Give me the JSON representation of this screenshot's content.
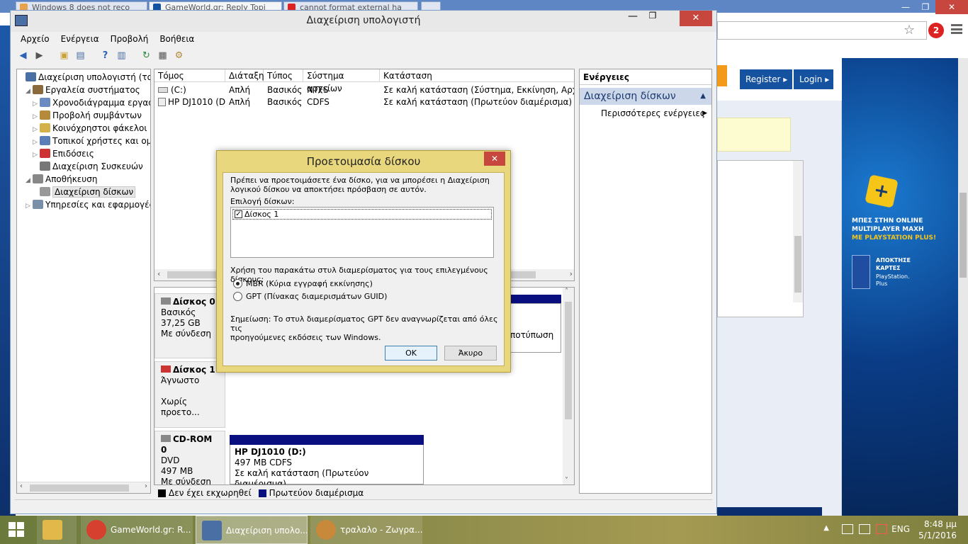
{
  "browser": {
    "tabs": [
      {
        "label": "Windows 8 does not reco",
        "color": "#e8a24a"
      },
      {
        "label": "GameWorld.gr: Reply Topi",
        "color": "#1553a0"
      },
      {
        "label": "cannot format external ha",
        "color": "#d22"
      }
    ],
    "ext_badge": "2",
    "site": {
      "register": "Register ▸",
      "login": "Login ▸",
      "ps_line1": "ΜΠΕΣ ΣΤΗΝ ONLINE",
      "ps_line2": "MULTIPLAYER ΜΑΧΗ",
      "ps_line3": "ΜΕ PLAYSTATION PLUS!",
      "ps_card1": "ΑΠΟΚΤΗΣΕ",
      "ps_card2": "ΚΑΡΤΕΣ",
      "ps_card3": "PlayStation.",
      "ps_card4": "Plus"
    }
  },
  "window": {
    "title": "Διαχείριση υπολογιστή",
    "close": "✕",
    "minimize": "—",
    "maximize": "❐"
  },
  "menubar": [
    "Αρχείο",
    "Ενέργεια",
    "Προβολή",
    "Βοήθεια"
  ],
  "tree": [
    {
      "label": "Διαχείριση υπολογιστή (τοπικού",
      "indent": 0,
      "icon": "computer-icon",
      "color": "#4a6fa5",
      "expander": ""
    },
    {
      "label": "Εργαλεία συστήματος",
      "indent": 1,
      "icon": "tools-icon",
      "color": "#8a6a3a",
      "expander": "◢"
    },
    {
      "label": "Χρονοδιάγραμμα εργασιώ",
      "indent": 2,
      "icon": "clock-icon",
      "color": "#6b8cc2",
      "expander": "▷"
    },
    {
      "label": "Προβολή συμβάντων",
      "indent": 2,
      "icon": "event-viewer-icon",
      "color": "#b58a3a",
      "expander": "▷"
    },
    {
      "label": "Κοινόχρηστοι φάκελοι",
      "indent": 2,
      "icon": "shared-folder-icon",
      "color": "#d4b24a",
      "expander": "▷"
    },
    {
      "label": "Τοπικοί χρήστες και ομάδ",
      "indent": 2,
      "icon": "users-icon",
      "color": "#5a7fb8",
      "expander": "▷"
    },
    {
      "label": "Επιδόσεις",
      "indent": 2,
      "icon": "performance-icon",
      "color": "#c33",
      "expander": "▷"
    },
    {
      "label": "Διαχείριση Συσκευών",
      "indent": 2,
      "icon": "device-manager-icon",
      "color": "#777",
      "expander": ""
    },
    {
      "label": "Αποθήκευση",
      "indent": 1,
      "icon": "storage-icon",
      "color": "#888",
      "expander": "◢"
    },
    {
      "label": "Διαχείριση δίσκων",
      "indent": 2,
      "icon": "disk-management-icon",
      "color": "#999",
      "expander": "",
      "selected": true
    },
    {
      "label": "Υπηρεσίες και εφαρμογές",
      "indent": 1,
      "icon": "services-icon",
      "color": "#7a8fa8",
      "expander": "▷"
    }
  ],
  "volume_table": {
    "headers": [
      "Τόμος",
      "Διάταξη",
      "Τύπος",
      "Σύστημα αρχείων",
      "Κατάσταση"
    ],
    "rows": [
      [
        "(C:)",
        "Απλή",
        "Βασικός",
        "NTFS",
        "Σε καλή κατάσταση (Σύστημα, Εκκίνηση, Αρχείο σελ"
      ],
      [
        "HP DJ1010 (D:)",
        "Απλή",
        "Βασικός",
        "CDFS",
        "Σε καλή κατάσταση (Πρωτεύον διαμέρισμα)"
      ]
    ]
  },
  "disks": {
    "d0": {
      "name": "Δίσκος 0",
      "type": "Βασικός",
      "size": "37,25 GB",
      "status": "Με σύνδεση",
      "partition_text": "ποτύπωση"
    },
    "d1": {
      "name": "Δίσκος 1",
      "type": "Άγνωστο",
      "status": "Χωρίς προετο..."
    },
    "cd": {
      "name": "CD-ROM 0",
      "type": "DVD",
      "size": "497 MB",
      "status": "Με σύνδεση",
      "vol_name": "HP DJ1010  (D:)",
      "vol_size": "497 MB CDFS",
      "vol_status": "Σε καλή κατάσταση (Πρωτεύον διαμέρισμα)"
    }
  },
  "legend": [
    {
      "label": "Δεν έχει εκχωρηθεί",
      "color": "#000000"
    },
    {
      "label": "Πρωτεύον διαμέρισμα",
      "color": "#0a0f80"
    }
  ],
  "actions": {
    "header": "Ενέργειες",
    "section": "Διαχείριση δίσκων",
    "more": "Περισσότερες ενέργειες"
  },
  "dialog": {
    "title": "Προετοιμασία δίσκου",
    "close": "✕",
    "intro_line1": "Πρέπει να προετοιμάσετε ένα δίσκο, για να μπορέσει η Διαχείριση",
    "intro_line2": "λογικού δίσκου να αποκτήσει πρόσβαση σε αυτόν.",
    "select_label": "Επιλογή δίσκων:",
    "disk_item": "Δίσκος 1",
    "disk_checked": "✓",
    "style_label": "Χρήση του παρακάτω στυλ διαμερίσματος για τους επιλεγμένους δίσκους:",
    "mbr": "MBR (Κύρια εγγραφή εκκίνησης)",
    "gpt": "GPT (Πίνακας διαμερισμάτων GUID)",
    "note_line1": "Σημείωση: Το στυλ διαμερίσματος GPT δεν αναγνωρίζεται από όλες τις",
    "note_line2": "προηγούμενες εκδόσεις των Windows.",
    "ok": "OK",
    "cancel": "Άκυρο"
  },
  "taskbar": {
    "tasks": [
      {
        "label": "",
        "icon": "file-explorer-icon",
        "color": "#e2b84a"
      },
      {
        "label": "GameWorld.gr: R...",
        "icon": "chrome-icon",
        "color": "#d6412f"
      },
      {
        "label": "Διαχείριση υπολο...",
        "icon": "computer-management-icon",
        "color": "#4a6fa5"
      },
      {
        "label": "τραλαλο - Ζωγρα...",
        "icon": "paint-icon",
        "color": "#c88a3a"
      }
    ],
    "lang": "ENG",
    "time": "8:48 μμ",
    "date": "5/1/2016"
  }
}
